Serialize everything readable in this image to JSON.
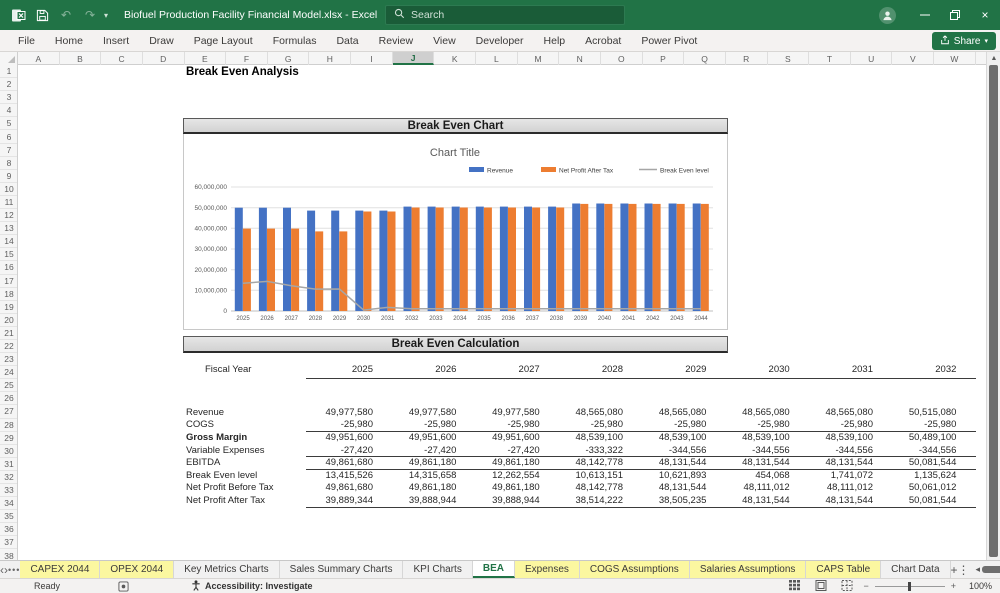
{
  "title_bar": {
    "document_title": "Biofuel Production Facility Financial Model.xlsx - Excel",
    "search_placeholder": "Search"
  },
  "ribbon": {
    "tabs": [
      "File",
      "Home",
      "Insert",
      "Draw",
      "Page Layout",
      "Formulas",
      "Data",
      "Review",
      "View",
      "Developer",
      "Help",
      "Acrobat",
      "Power Pivot"
    ],
    "share_label": "Share"
  },
  "grid": {
    "columns": [
      "A",
      "B",
      "C",
      "D",
      "E",
      "F",
      "G",
      "H",
      "I",
      "J",
      "K",
      "L",
      "M",
      "N",
      "O",
      "P",
      "Q",
      "R",
      "S",
      "T",
      "U",
      "V",
      "W"
    ],
    "selected_column": "J",
    "first_row": 1,
    "last_row": 38
  },
  "sheet": {
    "title": "Break Even Analysis",
    "chart_header": "Break Even Chart",
    "calc_header": "Break Even Calculation"
  },
  "chart_data": {
    "type": "bar",
    "title": "Chart Title",
    "categories": [
      "2025",
      "2026",
      "2027",
      "2028",
      "2029",
      "2030",
      "2031",
      "2032",
      "2033",
      "2034",
      "2035",
      "2036",
      "2037",
      "2038",
      "2039",
      "2040",
      "2041",
      "2042",
      "2043",
      "2044"
    ],
    "series": [
      {
        "name": "Revenue",
        "type": "bar",
        "color": "#4472C4",
        "values": [
          49977580,
          49977580,
          49977580,
          48565080,
          48565080,
          48565080,
          48565080,
          50515080,
          50515080,
          50515080,
          50515080,
          50515080,
          50515080,
          50515080,
          52000000,
          52000000,
          52000000,
          52000000,
          52000000,
          52000000
        ]
      },
      {
        "name": "Net Profit After Tax",
        "type": "bar",
        "color": "#ED7D31",
        "values": [
          39889344,
          39888944,
          39888944,
          38514222,
          38505235,
          48131544,
          48131544,
          50081544,
          50081544,
          50081544,
          50081544,
          50081544,
          50081544,
          50081544,
          51800000,
          51800000,
          51800000,
          51800000,
          51800000,
          51800000
        ]
      },
      {
        "name": "Break Even level",
        "type": "line",
        "color": "#A6A6A6",
        "values": [
          13415526,
          14315658,
          12262554,
          10613151,
          10621893,
          454068,
          1741072,
          1135624,
          1135624,
          1135624,
          1135624,
          1135624,
          1135624,
          1135624,
          1135624,
          1135624,
          1135624,
          1135624,
          1135624,
          1135624
        ]
      }
    ],
    "ylim": [
      0,
      60000000
    ],
    "ytick_step": 10000000,
    "legend_position": "top",
    "grid": true
  },
  "calc_table": {
    "row_header_label": "Fiscal Year",
    "years": [
      "2025",
      "2026",
      "2027",
      "2028",
      "2029",
      "2030",
      "2031",
      "2032"
    ],
    "rows": [
      {
        "label": "Revenue",
        "bold": false,
        "rule_below": false,
        "values": [
          "49,977,580",
          "49,977,580",
          "49,977,580",
          "48,565,080",
          "48,565,080",
          "48,565,080",
          "48,565,080",
          "50,515,080"
        ]
      },
      {
        "label": "COGS",
        "bold": false,
        "rule_below": true,
        "values": [
          "-25,980",
          "-25,980",
          "-25,980",
          "-25,980",
          "-25,980",
          "-25,980",
          "-25,980",
          "-25,980"
        ]
      },
      {
        "label": "Gross Margin",
        "bold": true,
        "rule_below": false,
        "values": [
          "49,951,600",
          "49,951,600",
          "49,951,600",
          "48,539,100",
          "48,539,100",
          "48,539,100",
          "48,539,100",
          "50,489,100"
        ]
      },
      {
        "label": "Variable Expenses",
        "bold": false,
        "rule_below": true,
        "values": [
          "-27,420",
          "-27,420",
          "-27,420",
          "-333,322",
          "-344,556",
          "-344,556",
          "-344,556",
          "-344,556"
        ]
      },
      {
        "label": "EBITDA",
        "bold": false,
        "rule_below": true,
        "values": [
          "49,861,680",
          "49,861,180",
          "49,861,180",
          "48,142,778",
          "48,131,544",
          "48,131,544",
          "48,131,544",
          "50,081,544"
        ]
      },
      {
        "label": "Break Even level",
        "bold": false,
        "rule_below": false,
        "values": [
          "13,415,526",
          "14,315,658",
          "12,262,554",
          "10,613,151",
          "10,621,893",
          "454,068",
          "1,741,072",
          "1,135,624"
        ]
      },
      {
        "label": "Net Profit Before Tax",
        "bold": false,
        "rule_below": false,
        "values": [
          "49,861,680",
          "49,861,180",
          "49,861,180",
          "48,142,778",
          "48,131,544",
          "48,111,012",
          "48,111,012",
          "50,061,012"
        ]
      },
      {
        "label": "Net Profit After Tax",
        "bold": false,
        "rule_below": true,
        "values": [
          "39,889,344",
          "39,888,944",
          "39,888,944",
          "38,514,222",
          "38,505,235",
          "48,131,544",
          "48,131,544",
          "50,081,544"
        ]
      }
    ]
  },
  "sheet_tabs": {
    "tabs": [
      {
        "label": "CAPEX 2044",
        "style": "yellow"
      },
      {
        "label": "OPEX 2044",
        "style": "yellow"
      },
      {
        "label": "Key Metrics Charts",
        "style": "plain"
      },
      {
        "label": "Sales Summary Charts",
        "style": "plain"
      },
      {
        "label": "KPI Charts",
        "style": "plain"
      },
      {
        "label": "BEA",
        "style": "active"
      },
      {
        "label": "Expenses",
        "style": "yellow"
      },
      {
        "label": "COGS Assumptions",
        "style": "yellow"
      },
      {
        "label": "Salaries Assumptions",
        "style": "yellow"
      },
      {
        "label": "CAPS Table",
        "style": "yellow"
      },
      {
        "label": "Chart Data",
        "style": "plain"
      }
    ]
  },
  "status_bar": {
    "ready_label": "Ready",
    "accessibility_label": "Accessibility: Investigate",
    "zoom_level": "100%"
  },
  "colors": {
    "excel_green": "#217346",
    "bar_blue": "#4472C4",
    "bar_orange": "#ED7D31",
    "line_gray": "#A6A6A6",
    "tab_yellow": "#FBF7A0"
  }
}
